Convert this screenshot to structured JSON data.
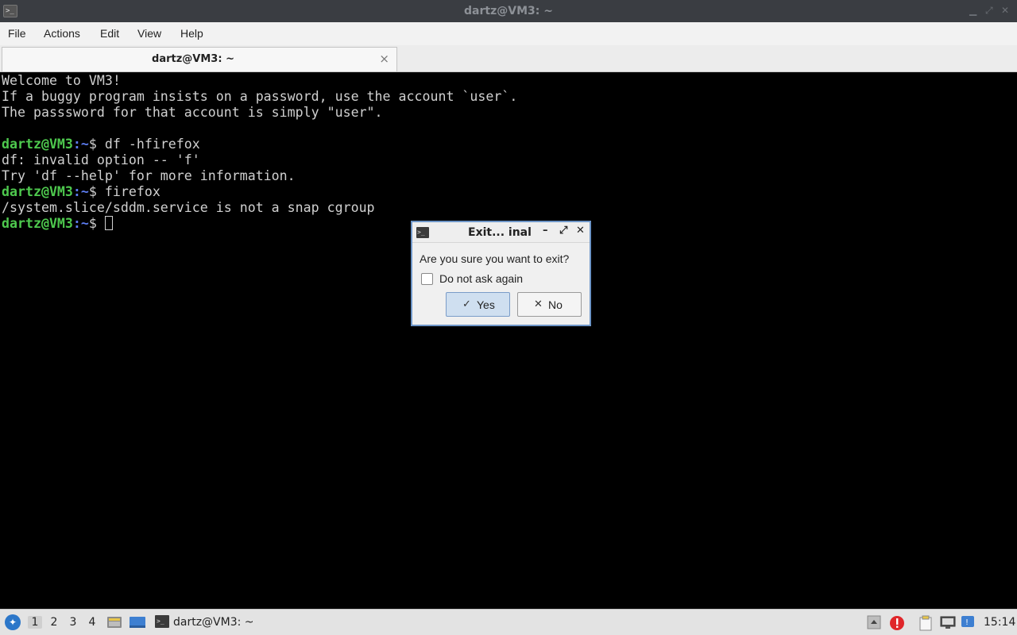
{
  "window": {
    "title": "dartz@VM3: ~",
    "icon": "terminal-icon"
  },
  "menu": [
    "File",
    "Actions",
    "Edit",
    "View",
    "Help"
  ],
  "tab": {
    "label": "dartz@VM3: ~",
    "close": "×"
  },
  "terminal": {
    "lines": [
      {
        "text": "Welcome to VM3!"
      },
      {
        "text": "If a buggy program insists on a password, use the account `user`."
      },
      {
        "text": "The passsword for that account is simply \"user\"."
      },
      {
        "text": ""
      },
      {
        "user": "dartz@VM3",
        "path": ":~",
        "cmd": "$ df -hfirefox"
      },
      {
        "text": "df: invalid option -- 'f'"
      },
      {
        "text": "Try 'df --help' for more information."
      },
      {
        "user": "dartz@VM3",
        "path": ":~",
        "cmd": "$ firefox"
      },
      {
        "text": "/system.slice/sddm.service is not a snap cgroup"
      },
      {
        "user": "dartz@VM3",
        "path": ":~",
        "cmd": "$ ",
        "cursor": true
      }
    ],
    "colors": {
      "user": "#4ec94e",
      "path": "#5c7cf0",
      "text": "#d0d0d0"
    }
  },
  "dialog": {
    "title": "Exit... inal",
    "message": "Are you sure you want to exit?",
    "checkbox_label": "Do not ask again",
    "checkbox_checked": false,
    "yes_label": "Yes",
    "no_label": "No",
    "yes_icon": "✓",
    "no_icon": "✕",
    "ctl_minimize": "–",
    "ctl_maximize": "⤢",
    "ctl_close": "✕"
  },
  "taskbar": {
    "workspaces": [
      "1",
      "2",
      "3",
      "4"
    ],
    "active_workspace": "1",
    "task_label": "dartz@VM3: ~",
    "clock": "15:14"
  }
}
